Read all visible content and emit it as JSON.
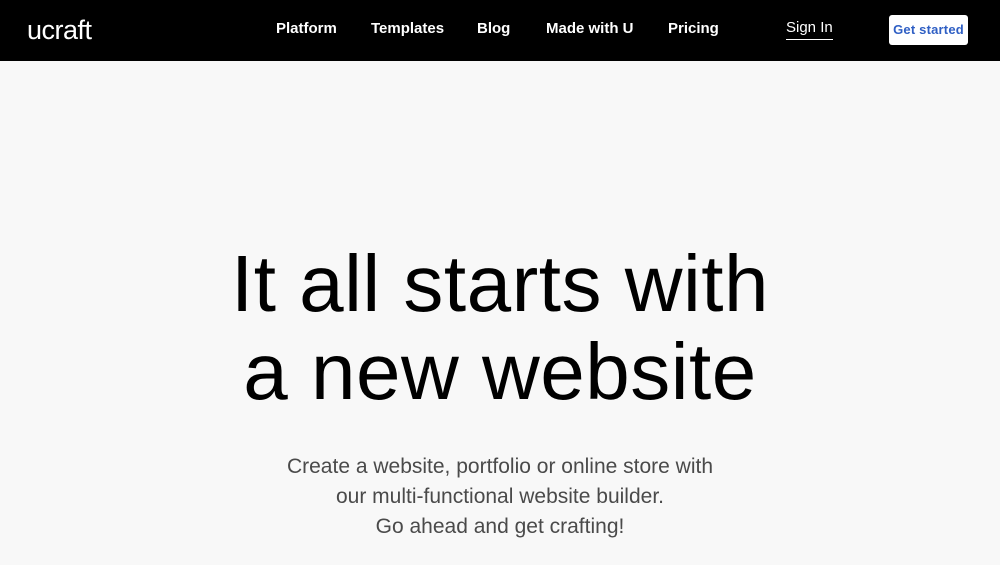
{
  "header": {
    "logo": "ucraft",
    "nav": [
      "Platform",
      "Templates",
      "Blog",
      "Made with U",
      "Pricing"
    ],
    "sign_in": "Sign In",
    "get_started": "Get started"
  },
  "hero": {
    "title_line1": "It all starts with",
    "title_line2": "a new website",
    "subtitle_line1": "Create a website, portfolio or online store with",
    "subtitle_line2": "our multi-functional website builder.",
    "subtitle_line3": "Go ahead and get crafting!"
  },
  "colors": {
    "header_bg": "#000000",
    "page_bg": "#f8f8f8",
    "cta_text": "#2f5fc4"
  }
}
